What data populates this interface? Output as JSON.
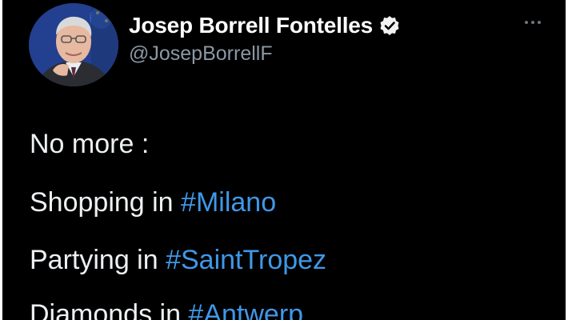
{
  "author": {
    "display_name": "Josep Borrell Fontelles",
    "handle": "@JosepBorrellF",
    "verified": true
  },
  "menu": {
    "icon": "more-dots-icon"
  },
  "tweet_lines": [
    {
      "text": "No more :",
      "hashtag": ""
    },
    {
      "text": "Shopping in ",
      "hashtag": "#Milano"
    },
    {
      "text": "Partying in ",
      "hashtag": "#SaintTropez"
    },
    {
      "text": "Diamonds in ",
      "hashtag": "#Antwerp"
    }
  ],
  "colors": {
    "background": "#000000",
    "text": "#e7e9ea",
    "secondary_text": "#8b98a5",
    "hashtag": "#3f98e8"
  }
}
